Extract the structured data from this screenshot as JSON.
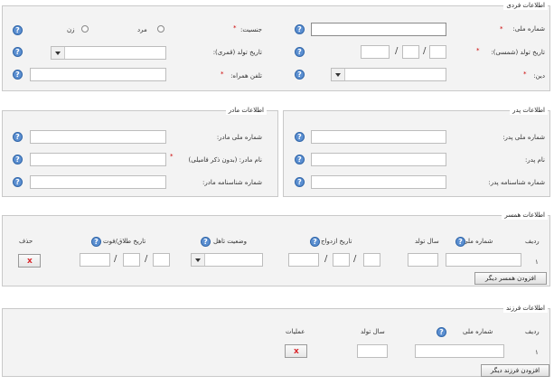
{
  "personal": {
    "legend": "اطلاعات فردی",
    "national_id_label": "شماره ملی:",
    "gender_label": "جنسیت:",
    "gender_male": "مرد",
    "gender_female": "زن",
    "birth_date_solar_label": "تاریخ تولد (شمسی):",
    "birth_date_lunar_label": "تاریخ تولد (قمری):",
    "religion_label": "دین:",
    "mobile_label": "تلفن همراه:",
    "required_mark": "*"
  },
  "mother": {
    "legend": "اطلاعات مادر",
    "national_id_label": "شماره ملی مادر:",
    "name_label": "نام مادر: (بدون ذکر فامیلی)",
    "id_number_label": "شماره شناسنامه مادر:"
  },
  "father": {
    "legend": "اطلاعات پدر",
    "national_id_label": "شماره ملی پدر:",
    "name_label": "نام پدر:",
    "id_number_label": "شماره شناسنامه پدر:"
  },
  "spouse": {
    "legend": "اطلاعات همسر",
    "col_row": "ردیف",
    "col_national_id": "شماره ملی",
    "col_birth_year": "سال تولد",
    "col_marriage_date": "تاریخ ازدواج",
    "col_marital_status": "وضعیت تاهل",
    "col_divorce_date": "تاریخ طلاق/فوت",
    "col_delete": "حذف",
    "row_number": "۱",
    "add_button": "افزودن همسر دیگر"
  },
  "children": {
    "legend": "اطلاعات فرزند",
    "col_row": "ردیف",
    "col_national_id": "شماره ملی",
    "col_birth_year": "سال تولد",
    "col_operations": "عملیات",
    "row_number": "۱",
    "add_button": "افزودن فرزند دیگر"
  },
  "common": {
    "help_glyph": "?",
    "date_sep": "/",
    "delete_glyph": "x"
  }
}
